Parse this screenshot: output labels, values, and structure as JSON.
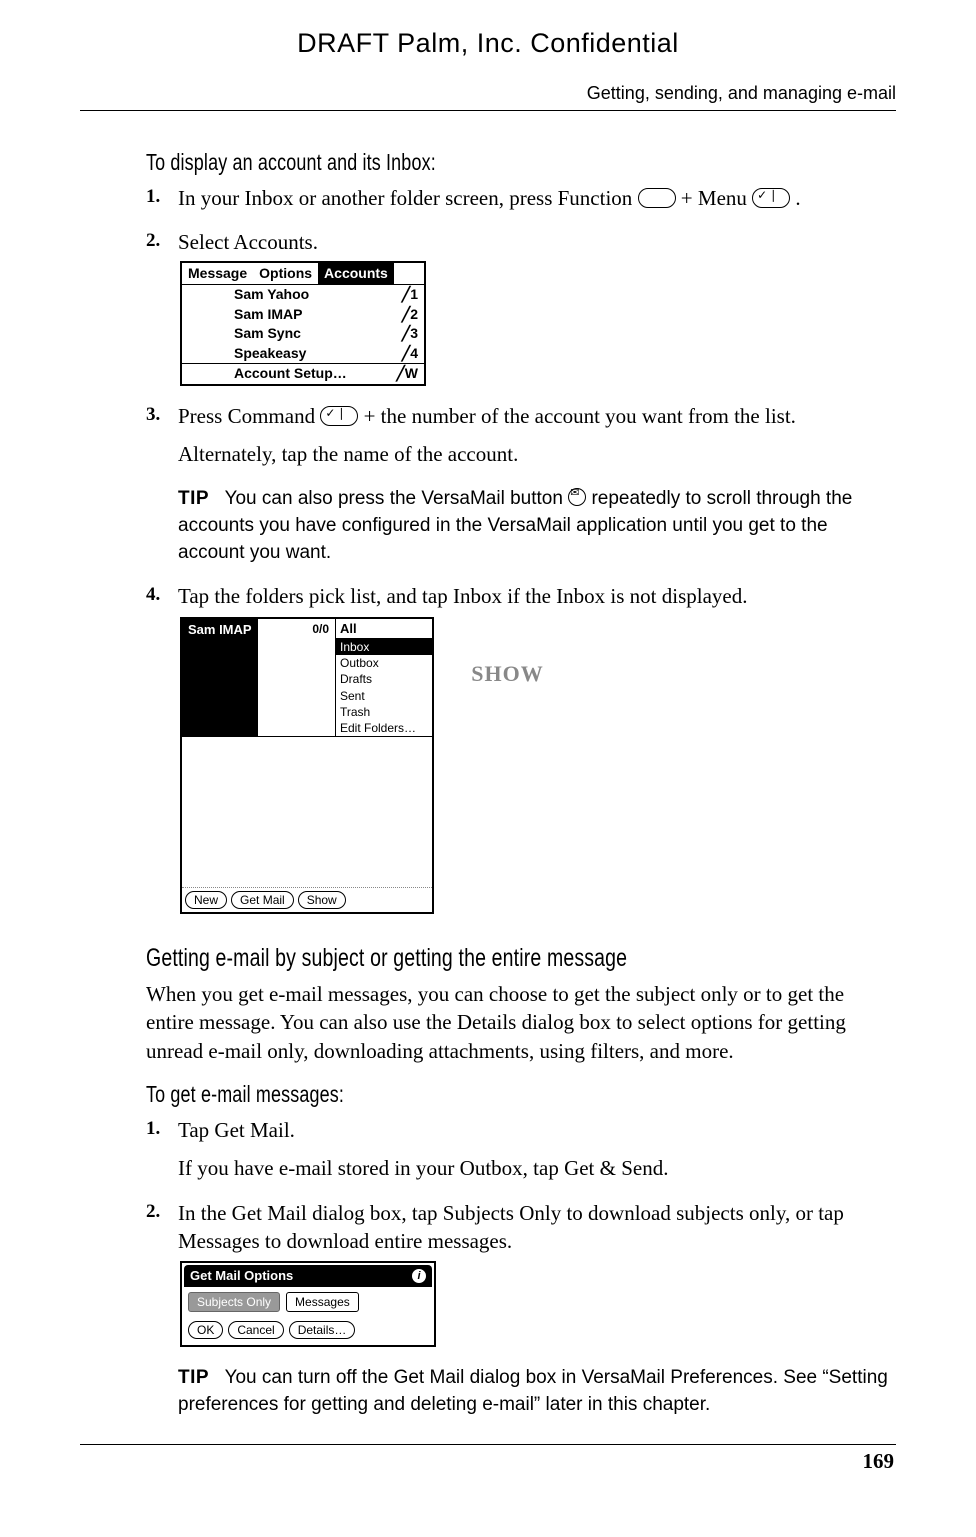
{
  "header": {
    "draft": "DRAFT   Palm, Inc. Confidential",
    "running": "Getting, sending, and managing e-mail"
  },
  "sec1": {
    "subhead": "To display an account and its Inbox:",
    "steps": {
      "s1a": "In your Inbox or another folder screen, press Function ",
      "s1b": " + Menu ",
      "s1c": ".",
      "s2": "Select Accounts.",
      "s3a": "Press Command ",
      "s3b": " + the number of the account you want from the list.",
      "s3sub": "Alternately, tap the name of the account.",
      "tip3a": "You can also press the VersaMail button ",
      "tip3b": " repeatedly to scroll through the accounts you have configured in the VersaMail application until you get to the account you want.",
      "s4": "Tap the folders pick list, and tap Inbox if the Inbox is not displayed."
    }
  },
  "menu1": {
    "tabs": [
      "Message",
      "Options",
      "Accounts"
    ],
    "rows": [
      {
        "label": "Sam Yahoo",
        "sc": "╱1"
      },
      {
        "label": "Sam IMAP",
        "sc": "╱2"
      },
      {
        "label": "Sam Sync",
        "sc": "╱3"
      },
      {
        "label": "Speakeasy",
        "sc": "╱4"
      }
    ],
    "setup": {
      "label": "Account Setup…",
      "sc": "╱W"
    }
  },
  "app": {
    "name": "Sam IMAP",
    "count": "0/0",
    "pick_top": "All",
    "options": [
      "Inbox",
      "Outbox",
      "Drafts",
      "Sent",
      "Trash",
      "Edit Folders…"
    ],
    "buttons": {
      "new": "New",
      "get": "Get Mail",
      "show": "Show"
    },
    "callout": "SHOW"
  },
  "sec2": {
    "head": "Getting e-mail by subject or getting the entire message",
    "intro": "When you get e-mail messages, you can choose to get the subject only or to get the entire message. You can also use the Details dialog box to select options for getting unread e-mail only, downloading attachments, using filters, and more.",
    "subhead": "To get e-mail messages:",
    "s1": "Tap Get Mail.",
    "s1sub": "If you have e-mail stored in your Outbox, tap Get & Send.",
    "s2": "In the Get Mail dialog box, tap Subjects Only to download subjects only, or tap Messages to download entire messages.",
    "tip_a": "You can turn off the Get Mail dialog box in VersaMail Preferences. See ",
    "tip_link": "“Setting preferences for getting and deleting e-mail”",
    "tip_b": " later in this chapter."
  },
  "dialog": {
    "title": "Get Mail Options",
    "tab1": "Subjects Only",
    "tab2": "Messages",
    "ok": "OK",
    "cancel": "Cancel",
    "details": "Details…"
  },
  "labels": {
    "tip": "TIP"
  },
  "page_number": "169"
}
